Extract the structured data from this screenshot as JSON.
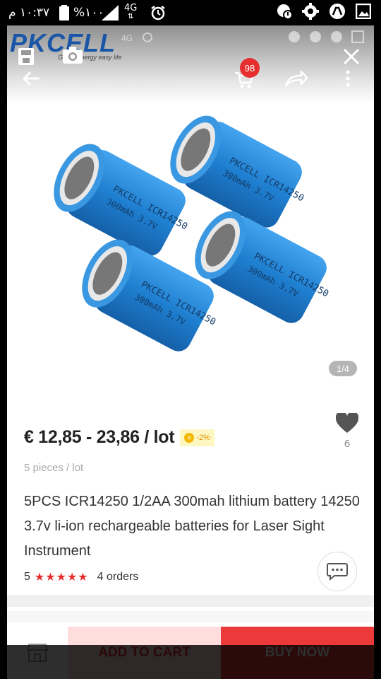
{
  "status_bar": {
    "time": "١٠:٣٧ م",
    "battery": "%١٠٠",
    "network": "4G",
    "network_arrows": "⇅"
  },
  "overlay": {
    "ghost_network": "4G"
  },
  "brand": {
    "logo_text": "PKCELL",
    "tagline": "Green energy easy life"
  },
  "header": {
    "cart_count": "98"
  },
  "gallery": {
    "counter": "1/4"
  },
  "product": {
    "price": "€ 12,85 - 23,86 / lot",
    "discount": "-2%",
    "coin_symbol": "¤",
    "wishlist_count": "6",
    "pieces": "5 pieces / lot",
    "title": "5PCS ICR14250 1/2AA 300mah lithium battery 14250 3.7v li-ion rechargeable batteries for Laser Sight Instrument",
    "rating": "5",
    "stars": "★★★★★",
    "orders": "4 orders",
    "battery_label": "PKCELL ICR14250",
    "battery_spec": "300mAh 3.7V"
  },
  "actions": {
    "add_to_cart": "ADD TO CART",
    "buy_now": "BUY NOW"
  },
  "colors": {
    "accent_red": "#e62e2e",
    "battery_blue": "#1f7fd0",
    "brand_blue": "#1a56a8",
    "badge_yellow": "#f3b800"
  }
}
